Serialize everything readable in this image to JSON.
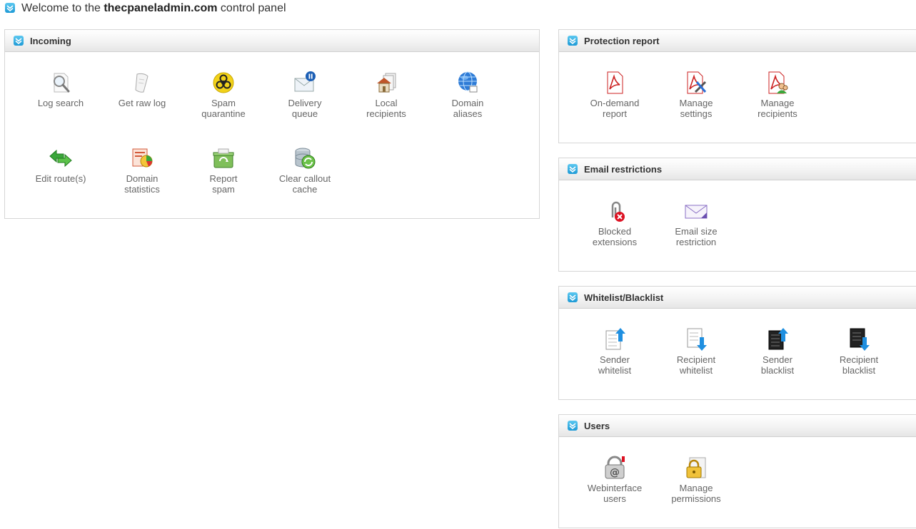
{
  "welcome": {
    "prefix": "Welcome to the ",
    "domain": "thecpaneladmin.com",
    "suffix": " control panel"
  },
  "panels": {
    "incoming": {
      "title": "Incoming",
      "items": [
        {
          "label": "Log search",
          "icon": "magnifier-icon"
        },
        {
          "label": "Get raw log",
          "icon": "scroll-icon"
        },
        {
          "label": "Spam\nquarantine",
          "icon": "biohazard-icon"
        },
        {
          "label": "Delivery\nqueue",
          "icon": "mail-pause-icon"
        },
        {
          "label": "Local\nrecipients",
          "icon": "house-icon"
        },
        {
          "label": "Domain\naliases",
          "icon": "globe-icon"
        },
        {
          "label": "Edit route(s)",
          "icon": "arrows-icon"
        },
        {
          "label": "Domain\nstatistics",
          "icon": "chart-icon"
        },
        {
          "label": "Report\nspam",
          "icon": "recycle-bin-icon"
        },
        {
          "label": "Clear callout\ncache",
          "icon": "database-refresh-icon"
        }
      ]
    },
    "protection": {
      "title": "Protection report",
      "items": [
        {
          "label": "On-demand\nreport",
          "icon": "pdf-icon"
        },
        {
          "label": "Manage\nsettings",
          "icon": "pdf-settings-icon"
        },
        {
          "label": "Manage\nrecipients",
          "icon": "pdf-users-icon"
        }
      ]
    },
    "restrictions": {
      "title": "Email restrictions",
      "items": [
        {
          "label": "Blocked\nextensions",
          "icon": "blocked-attachment-icon"
        },
        {
          "label": "Email size\nrestriction",
          "icon": "envelope-icon"
        }
      ]
    },
    "lists": {
      "title": "Whitelist/Blacklist",
      "items": [
        {
          "label": "Sender\nwhitelist",
          "icon": "white-list-up-icon"
        },
        {
          "label": "Recipient\nwhitelist",
          "icon": "white-list-down-icon"
        },
        {
          "label": "Sender\nblacklist",
          "icon": "black-list-up-icon"
        },
        {
          "label": "Recipient\nblacklist",
          "icon": "black-list-down-icon"
        }
      ]
    },
    "users": {
      "title": "Users",
      "items": [
        {
          "label": "Webinterface\nusers",
          "icon": "at-lock-icon"
        },
        {
          "label": "Manage\npermissions",
          "icon": "padlock-icon"
        }
      ]
    }
  },
  "colors": {
    "accent": "#1e9ad6",
    "text": "#666666",
    "border": "#d6d6d6"
  }
}
